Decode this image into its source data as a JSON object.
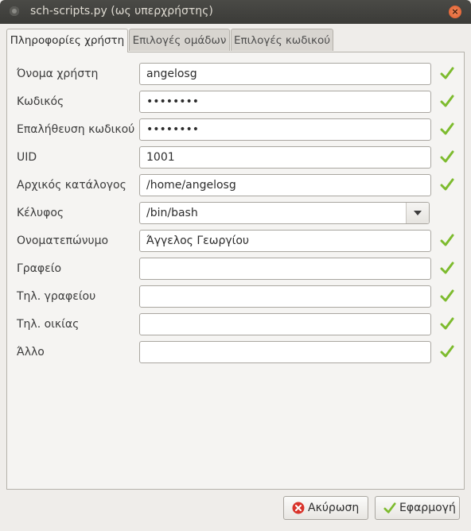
{
  "window": {
    "title": "sch-scripts.py (ως υπερχρήστης)",
    "close_glyph": "×"
  },
  "tabs": [
    {
      "label": "Πληροφορίες χρήστη",
      "active": true
    },
    {
      "label": "Επιλογές ομάδων",
      "active": false
    },
    {
      "label": "Επιλογές κωδικού",
      "active": false
    }
  ],
  "form": {
    "fields": [
      {
        "label": "Όνομα χρήστη",
        "value": "angelosg",
        "valid": true
      },
      {
        "label": "Κωδικός",
        "value": "••••••••",
        "valid": true
      },
      {
        "label": "Επαλήθευση κωδικού",
        "value": "••••••••",
        "valid": true
      },
      {
        "label": "UID",
        "value": "1001",
        "valid": true
      },
      {
        "label": "Αρχικός κατάλογος",
        "value": "/home/angelosg",
        "valid": true
      },
      {
        "label": "Κέλυφος",
        "value": "/bin/bash",
        "type": "combo"
      },
      {
        "label": "Ονοματεπώνυμο",
        "value": "Άγγελος Γεωργίου",
        "valid": true
      },
      {
        "label": "Γραφείο",
        "value": "",
        "valid": true
      },
      {
        "label": "Τηλ. γραφείου",
        "value": "",
        "valid": true
      },
      {
        "label": "Τηλ. οικίας",
        "value": "",
        "valid": true
      },
      {
        "label": "Άλλο",
        "value": "",
        "valid": true
      }
    ]
  },
  "buttons": {
    "cancel_label": "Ακύρωση",
    "apply_label": "Εφαρμογή"
  },
  "colors": {
    "valid_check": "#7dbb2e",
    "cancel_icon": "#d9342b",
    "titlebar": "#3b3b38"
  }
}
